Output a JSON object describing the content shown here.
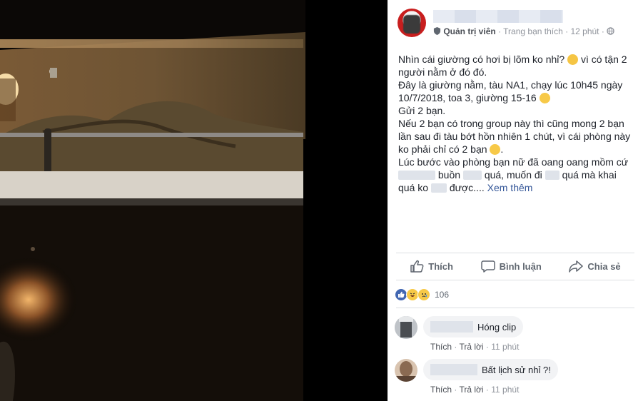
{
  "post": {
    "role": "Quản trị viên",
    "source": "Trang bạn thích",
    "time": "12 phút",
    "body": {
      "l1a": "Nhìn cái giường có hơi bị lõm ko nhỉ?",
      "l1b": "vì có tận 2 người nằm ở đó đó.",
      "l2": "Đây là giường nằm, tàu NA1, chạy lúc 10h45 ngày 10/7/2018, toa 3, giường 15-16",
      "l3": "Gửi 2 bạn.",
      "l4": "Nếu 2 bạn có trong group này thì cũng mong 2 bạn lần sau đi tàu bớt hồn nhiên 1 chút, vì cái phòng này ko phải chỉ có 2 bạn",
      "l5a": "Lúc bước vào phòng bạn nữ đã oang oang mồm cứ",
      "l5b": "buồn",
      "l5c": "quá, muốn đi",
      "l5d": "quá mà khai quá",
      "l6a": "ko",
      "l6b": "được....",
      "see_more": "Xem thêm"
    }
  },
  "actions": {
    "like": "Thích",
    "comment": "Bình luận",
    "share": "Chia sẻ"
  },
  "reactions": {
    "count": "106",
    "types": [
      "like-icon",
      "haha-icon",
      "sad-icon"
    ]
  },
  "comments": [
    {
      "text": "Hóng clip",
      "like": "Thích",
      "reply": "Trả lời",
      "time": "11 phút"
    },
    {
      "text": "Bất lịch sử nhỉ ?!",
      "like": "Thích",
      "reply": "Trả lời",
      "time": "11 phút"
    }
  ],
  "colors": {
    "link": "#365899",
    "text": "#1d2129",
    "muted": "#90949c",
    "action": "#606770",
    "like_blue": "#4267b2"
  }
}
